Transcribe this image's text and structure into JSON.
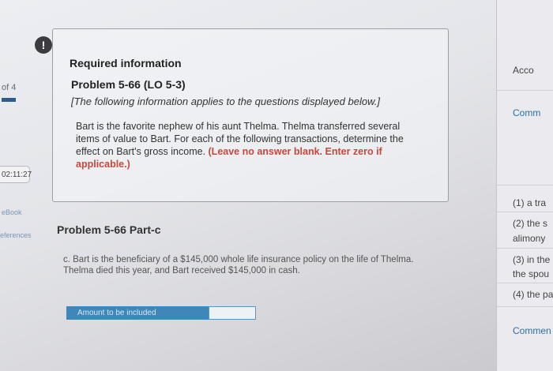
{
  "left_strip": {
    "page_of": "of 4",
    "timer": "02:11:27",
    "ebook": "eBook",
    "references": "eferences"
  },
  "info": {
    "alert": "!",
    "required": "Required information",
    "problem": "Problem 5-66 (LO 5-3)",
    "note": "[The following information applies to the questions displayed below.]",
    "body": "Bart is the favorite nephew of his aunt Thelma. Thelma transferred several items of value to Bart. For each of the following transactions, determine the effect on Bart's gross income. ",
    "body_highlight": "(Leave no answer blank. Enter zero if applicable.)"
  },
  "part": {
    "title": "Problem 5-66 Part-c",
    "question": "c. Bart is the beneficiary of a $145,000 whole life insurance policy on the life of Thelma. Thelma died this year, and Bart received $145,000 in cash.",
    "amount_label": "Amount to be included",
    "amount_value": ""
  },
  "right_panel": {
    "acco": "Acco",
    "comm": "Comm",
    "item1": "(1) a tra",
    "item2a": "(2) the s",
    "item2b": "alimony",
    "item3a": "(3) in the",
    "item3b": "the spou",
    "item4": "(4) the pa",
    "comment": "Commen"
  }
}
